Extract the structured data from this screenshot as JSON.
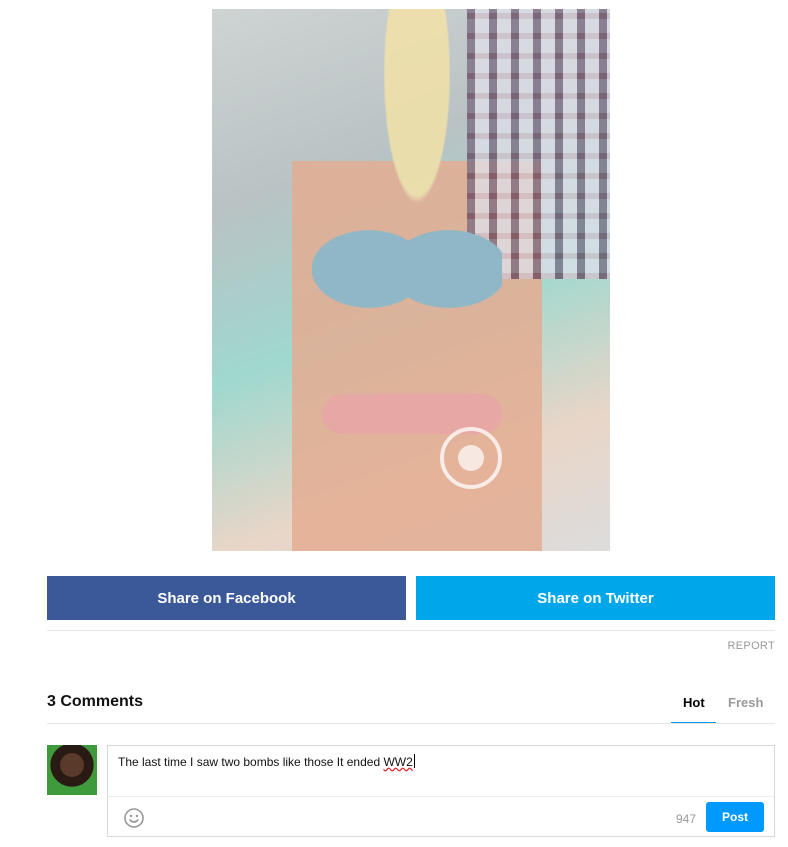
{
  "share": {
    "facebook_label": "Share on Facebook",
    "twitter_label": "Share on Twitter"
  },
  "report_label": "REPORT",
  "comments": {
    "count_label": "3 Comments",
    "tabs": [
      {
        "label": "Hot",
        "active": true
      },
      {
        "label": "Fresh",
        "active": false
      }
    ],
    "draft": {
      "text_main": "The last time I saw two bombs like those It ended ",
      "text_misspelled": "WW2",
      "remaining_chars": "947",
      "post_label": "Post"
    }
  },
  "icons": {
    "smiley": "smiley-icon",
    "cbs": "cbs-eye-icon"
  },
  "colors": {
    "facebook": "#3b5998",
    "twitter": "#00a6ea",
    "post": "#0099ff",
    "tab_underline": "#0099ff"
  }
}
